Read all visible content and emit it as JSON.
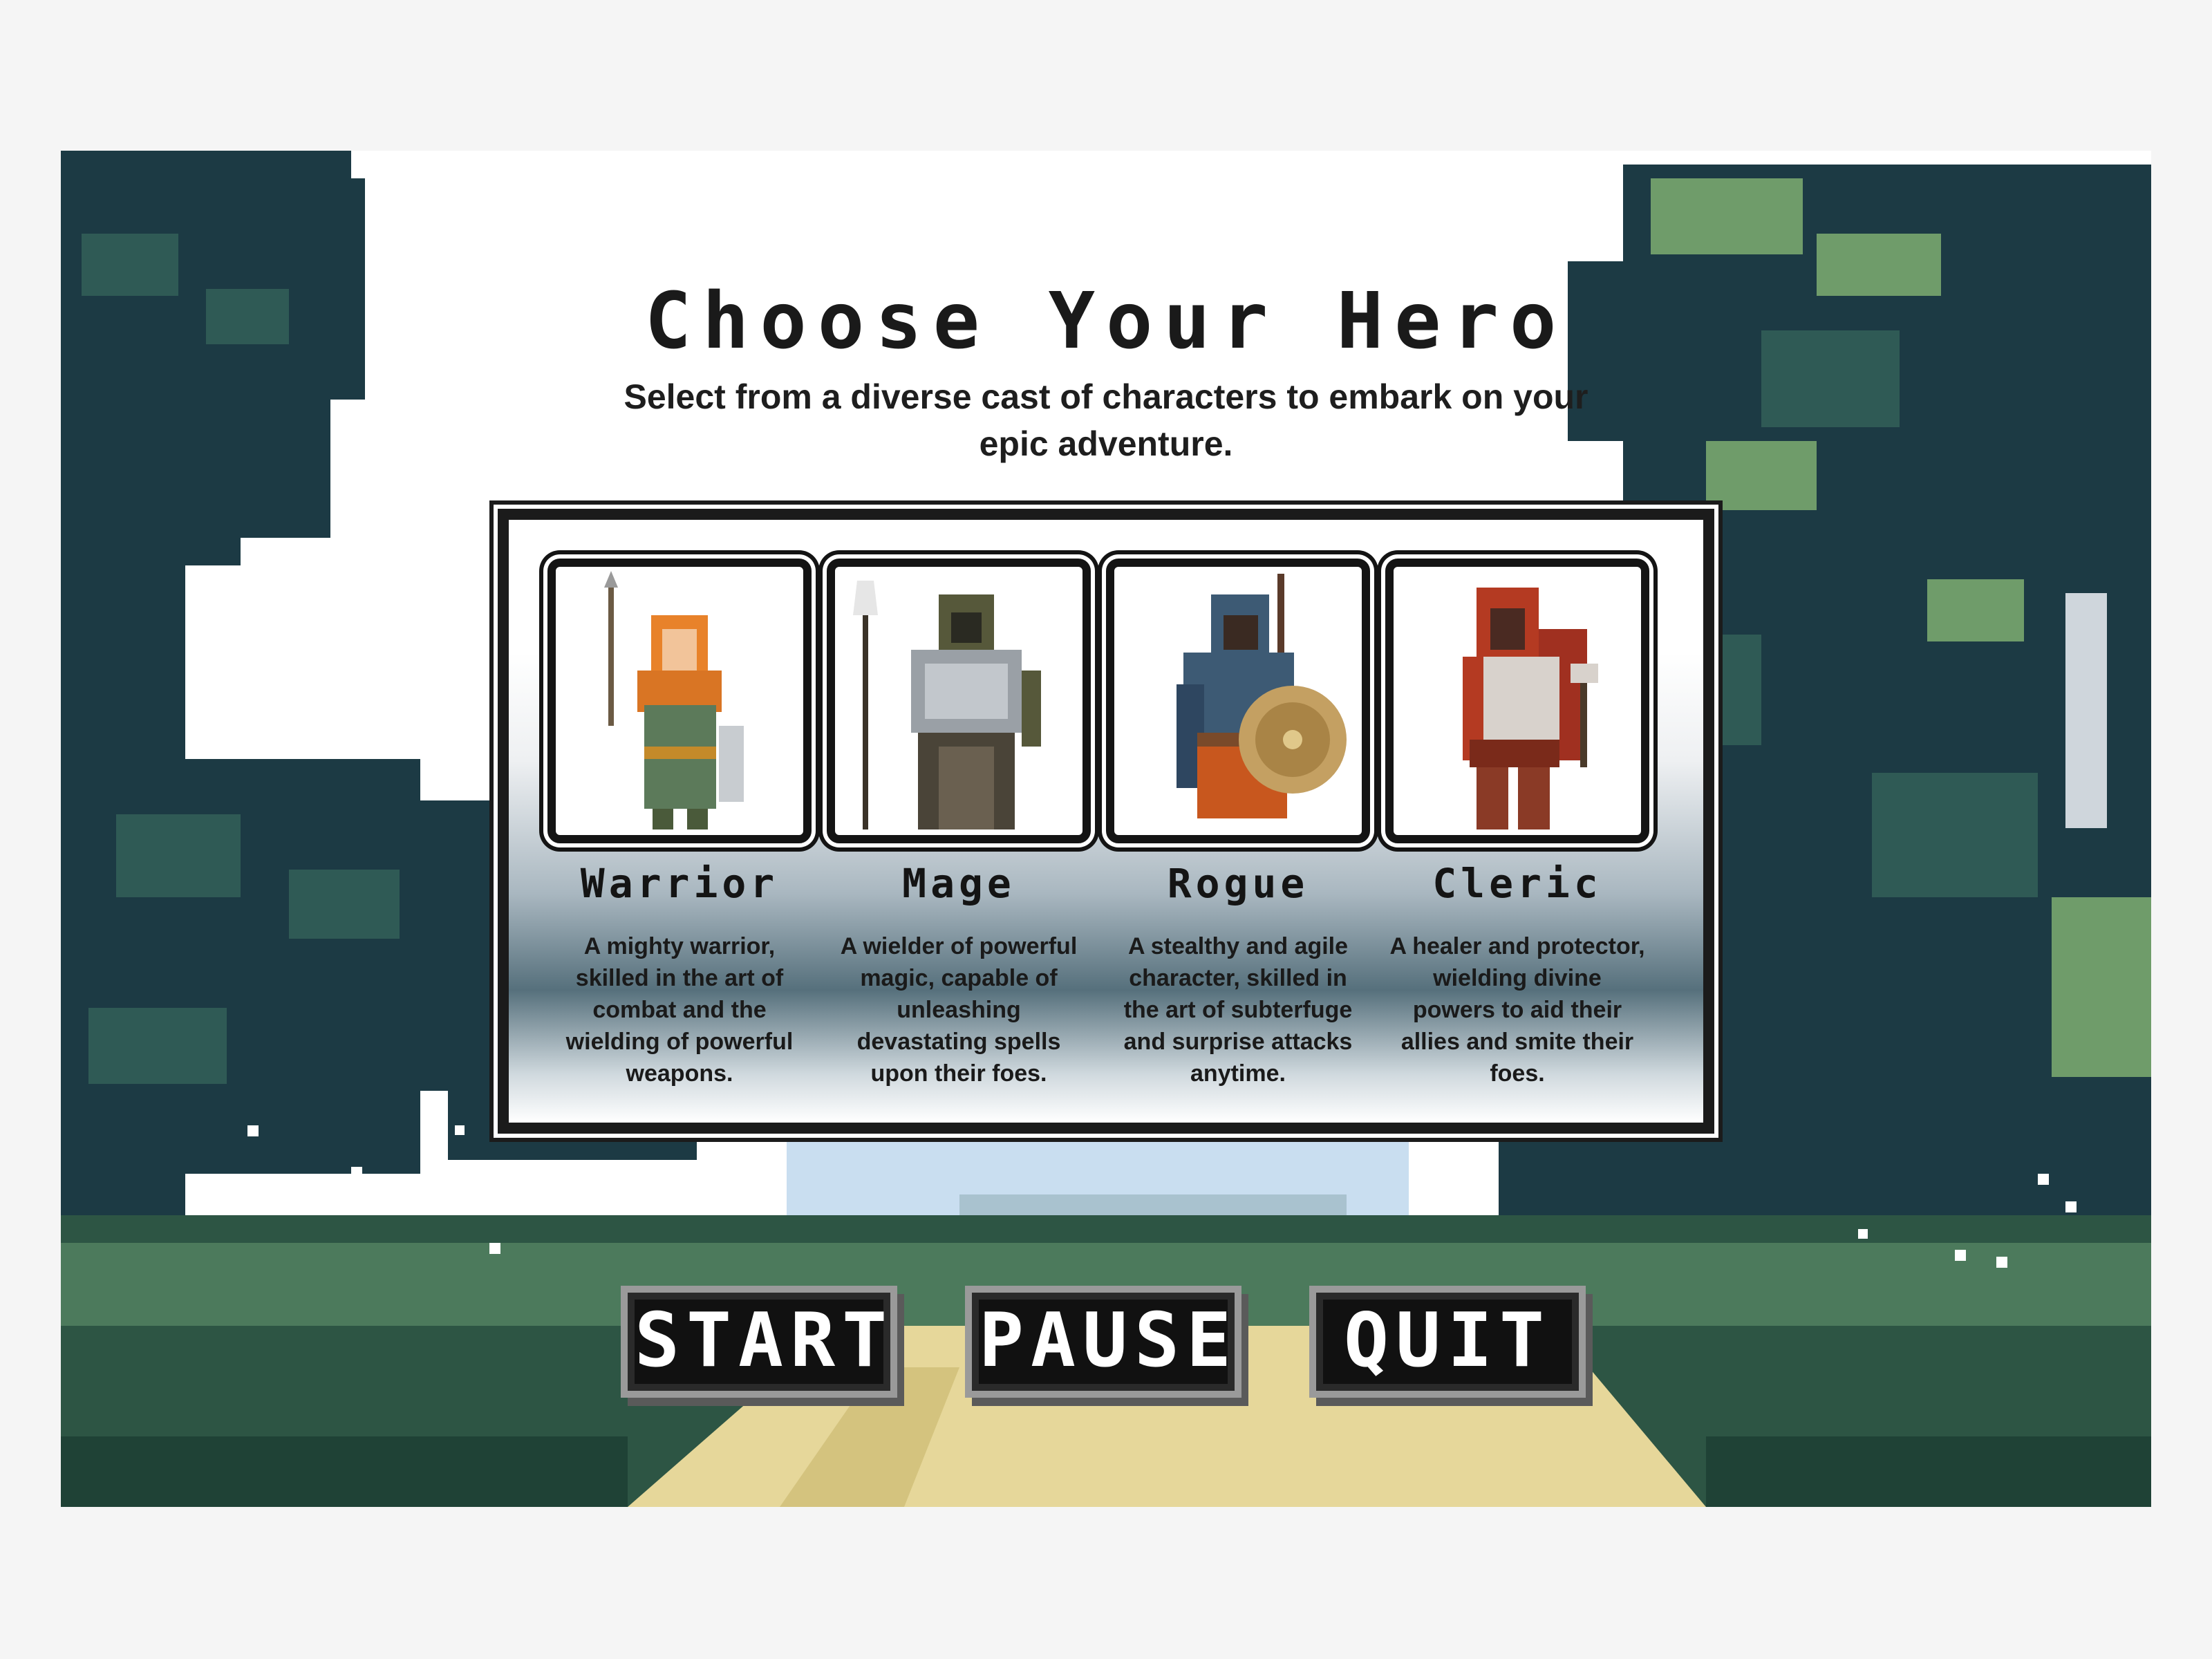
{
  "screen": {
    "title": "Choose Your Hero",
    "subtitle": "Select from a diverse cast of characters to embark on your epic adventure."
  },
  "heroes": [
    {
      "name": "Warrior",
      "description": "A mighty warrior, skilled in the art of combat and the wielding of powerful weapons.",
      "icon": "warrior-portrait",
      "accent": "#e8822a"
    },
    {
      "name": "Mage",
      "description": "A wielder of powerful magic, capable of unleashing devastating spells upon their foes.",
      "icon": "mage-portrait",
      "accent": "#56583a"
    },
    {
      "name": "Rogue",
      "description": "A stealthy and agile character, skilled in the art of subterfuge and surprise attacks anytime.",
      "icon": "rogue-portrait",
      "accent": "#3d5a74"
    },
    {
      "name": "Cleric",
      "description": "A healer and protector, wielding divine powers to aid their allies and smite their foes.",
      "icon": "cleric-portrait",
      "accent": "#b43a22"
    }
  ],
  "buttons": {
    "start": "START",
    "pause": "PAUSE",
    "quit": "QUIT"
  },
  "colors": {
    "forest_dark": "#1c3a44",
    "forest_mid": "#2f5a55",
    "leaf_light": "#6f9c6a",
    "path": "#e6d79a",
    "sky": "#c9def0"
  }
}
